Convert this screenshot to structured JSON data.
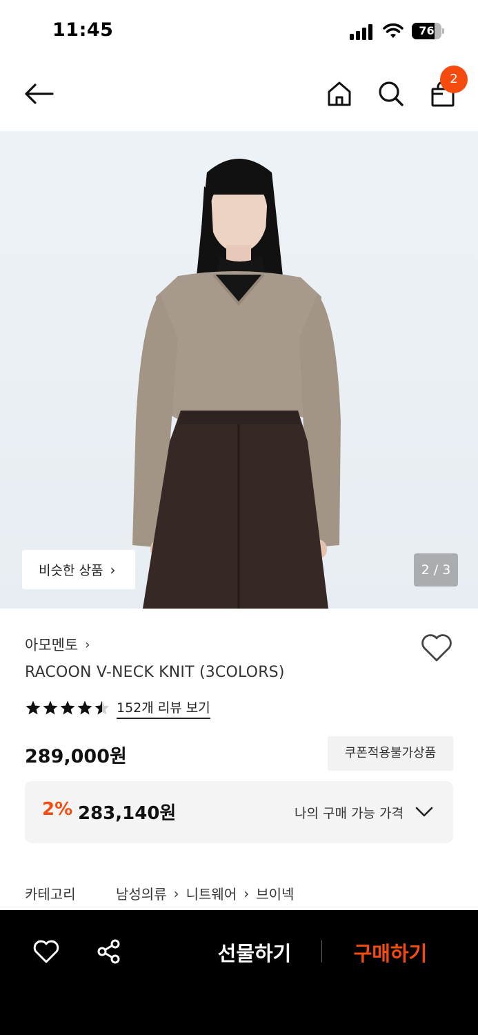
{
  "status_bar": {
    "time": "11:45",
    "battery_level": "76",
    "icons": [
      "signal-icon",
      "wifi-icon",
      "battery-icon"
    ]
  },
  "nav": {
    "icons": [
      "back-arrow-icon",
      "home-icon",
      "search-icon",
      "shopping-bag-icon"
    ],
    "cart_count": "2"
  },
  "gallery": {
    "similar_button": "비슷한 상품",
    "page_indicator": "2 / 3"
  },
  "product": {
    "brand": "아모멘토",
    "name": "RACOON V-NECK KNIT (3COLORS)",
    "rating": 4.5,
    "review_link": "152개 리뷰 보기",
    "price": "289,000원",
    "coupon_badge": "쿠폰적용불가상품",
    "discount_percent": "2%",
    "discount_price": "283,140원",
    "my_price_label": "나의 구매 가능 가격"
  },
  "category": {
    "label": "카테고리",
    "path": [
      "남성의류",
      "니트웨어",
      "브이넥"
    ]
  },
  "bottom_bar": {
    "gift_label": "선물하기",
    "buy_label": "구매하기"
  },
  "colors": {
    "accent": "#f54b0e",
    "bottom_bar_bg": "#000000",
    "discount_box_bg": "#f4f4f4"
  }
}
